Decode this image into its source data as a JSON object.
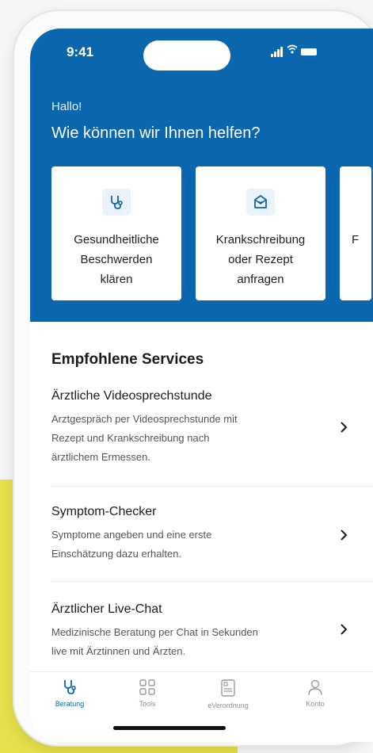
{
  "status": {
    "time": "9:41"
  },
  "header": {
    "greeting": "Hallo!",
    "headline": "Wie können wir Ihnen helfen?",
    "background": "#0a67ad"
  },
  "cards": [
    {
      "icon": "stethoscope-icon",
      "line1": "Gesundheitliche",
      "line2": "Beschwerden",
      "line3": "klären"
    },
    {
      "icon": "mail-heart-icon",
      "line1": "Krankschreibung",
      "line2": "oder Rezept",
      "line3": "anfragen"
    },
    {
      "icon": "",
      "line1": "F",
      "line2": "",
      "line3": ""
    }
  ],
  "services": {
    "title": "Empfohlene Services",
    "items": [
      {
        "title": "Ärztliche Videosprechstunde",
        "desc_lines": [
          "Arztgespräch per Videosprechstunde mit",
          "Rezept und Krankschreibung nach",
          "ärztlichem Ermessen."
        ]
      },
      {
        "title": "Symptom-Checker",
        "desc_lines": [
          "Symptome angeben und eine erste",
          "Einschätzung dazu erhalten."
        ]
      },
      {
        "title": "Ärztlicher Live-Chat",
        "desc_lines": [
          "Medizinische Beratung per Chat in Sekunden",
          "live mit Ärztinnen und Ärzten."
        ]
      }
    ]
  },
  "tabs": [
    {
      "label": "Beratung",
      "icon": "stethoscope-icon",
      "active": true
    },
    {
      "label": "Tools",
      "icon": "grid-icon",
      "active": false
    },
    {
      "label": "eVerordnung",
      "icon": "prescription-icon",
      "active": false
    },
    {
      "label": "Konto",
      "icon": "person-icon",
      "active": false
    }
  ],
  "colors": {
    "accent": "#0a67ad",
    "decor_yellow": "#e6e04a"
  }
}
